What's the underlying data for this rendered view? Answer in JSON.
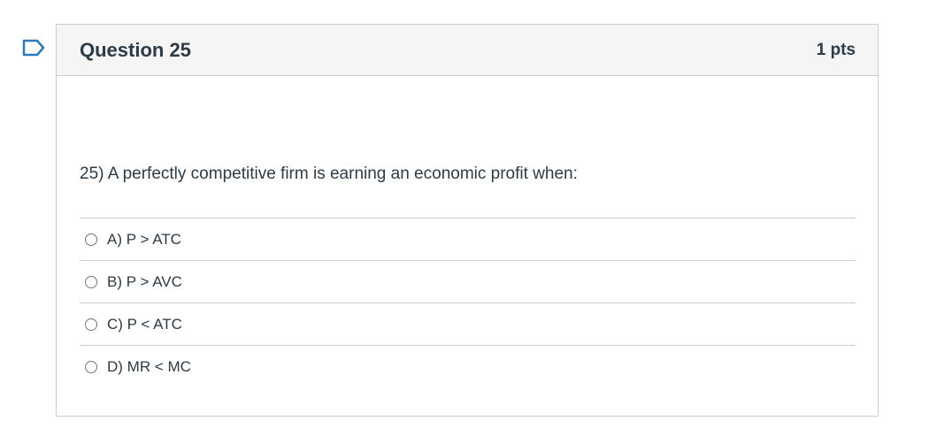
{
  "question": {
    "title": "Question 25",
    "points": "1 pts",
    "text": "25) A perfectly competitive firm is earning an economic profit when:",
    "answers": [
      {
        "label": "A) P > ATC"
      },
      {
        "label": "B) P > AVC"
      },
      {
        "label": "C) P < ATC"
      },
      {
        "label": "D) MR < MC"
      }
    ]
  },
  "icons": {
    "flag": "flag-question-icon"
  },
  "colors": {
    "flag": "#2b7abc",
    "border": "#c7cdd1",
    "header_bg": "#f5f5f5",
    "text": "#2d3b45"
  }
}
